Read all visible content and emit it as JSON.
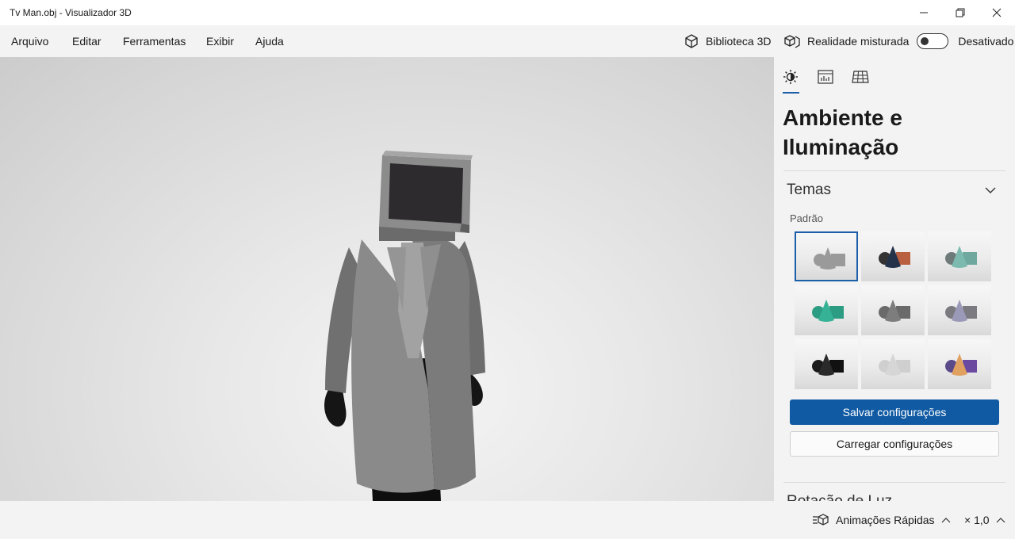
{
  "window": {
    "title": "Tv Man.obj - Visualizador 3D",
    "minimize_icon": "minimize-icon",
    "maximize_icon": "restore-icon",
    "close_icon": "close-icon"
  },
  "menu": {
    "items": [
      "Arquivo",
      "Editar",
      "Ferramentas",
      "Exibir",
      "Ajuda"
    ],
    "library_label": "Biblioteca 3D",
    "mixed_reality_label": "Realidade misturada",
    "toggle_state": "Desativado"
  },
  "panel": {
    "tabs": [
      "sun-icon",
      "stats-icon",
      "grid-icon"
    ],
    "title": "Ambiente e Iluminação",
    "themes_header": "Temas",
    "themes_sublabel": "Padrão",
    "themes": [
      {
        "name": "default",
        "colors": [
          "#9a9a9a",
          "#9a9a9a",
          "#9a9a9a"
        ],
        "selected": true
      },
      {
        "name": "dark-orange",
        "colors": [
          "#333333",
          "#25334a",
          "#b86040"
        ]
      },
      {
        "name": "teal",
        "colors": [
          "#6e7a7a",
          "#7cbab0",
          "#6ea89f"
        ]
      },
      {
        "name": "green",
        "colors": [
          "#2c9c82",
          "#36b296",
          "#2c9c82"
        ]
      },
      {
        "name": "gray",
        "colors": [
          "#6a6a6a",
          "#7d7d7d",
          "#6a6a6a"
        ]
      },
      {
        "name": "lavender",
        "colors": [
          "#7a7a80",
          "#9a9ab8",
          "#7a7a80"
        ]
      },
      {
        "name": "black",
        "colors": [
          "#1a1a1a",
          "#2a2a2a",
          "#111111"
        ]
      },
      {
        "name": "white",
        "colors": [
          "#cfcfcf",
          "#d6d6d6",
          "#cfcfcf"
        ]
      },
      {
        "name": "purple-orange",
        "colors": [
          "#5a4a8a",
          "#e0a060",
          "#6a4aa0"
        ]
      }
    ],
    "save_button": "Salvar configurações",
    "load_button": "Carregar configurações",
    "next_section": "Rotação de Luz"
  },
  "status": {
    "animations_label": "Animações Rápidas",
    "speed": "× 1,0"
  }
}
